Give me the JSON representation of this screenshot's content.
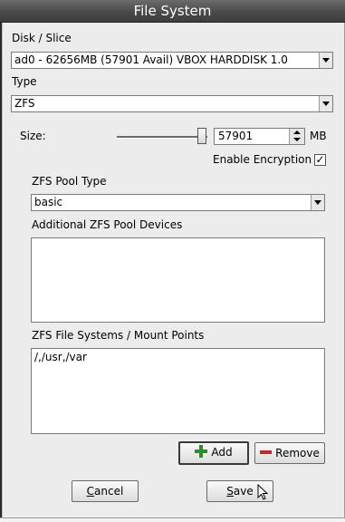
{
  "window": {
    "title": "File System"
  },
  "disk": {
    "label": "Disk / Slice",
    "selected": "ad0 - 62656MB (57901 Avail) VBOX HARDDISK 1.0"
  },
  "type": {
    "label": "Type",
    "selected": "ZFS"
  },
  "size": {
    "label": "Size:",
    "value": "57901",
    "unit": "MB",
    "slider_fraction": 1.0
  },
  "encryption": {
    "label": "Enable Encryption",
    "checked": true
  },
  "zfs_pool": {
    "label": "ZFS Pool Type",
    "selected": "basic"
  },
  "pool_devices": {
    "label": "Additional ZFS Pool Devices",
    "items": []
  },
  "filesystems": {
    "label": "ZFS File Systems / Mount Points",
    "items": [
      "/,/usr,/var"
    ]
  },
  "buttons": {
    "add": "Add",
    "remove": "Remove",
    "cancel_mnemonic": "C",
    "cancel_rest": "ancel",
    "save_mnemonic": "S",
    "save_rest": "ave"
  }
}
